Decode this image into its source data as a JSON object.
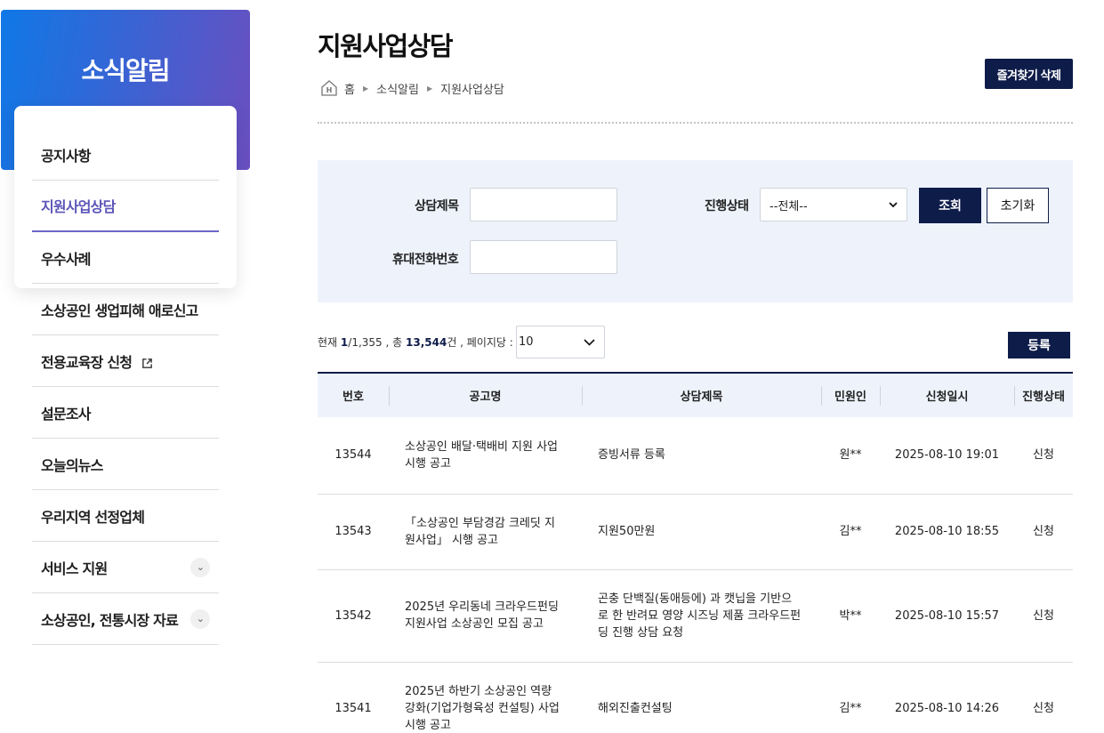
{
  "sidebar": {
    "title": "소식알림",
    "items": [
      {
        "label": "공지사항"
      },
      {
        "label": "지원사업상담"
      },
      {
        "label": "우수사례"
      },
      {
        "label": "소상공인 생업피해 애로신고"
      },
      {
        "label": "전용교육장 신청"
      },
      {
        "label": "설문조사"
      },
      {
        "label": "오늘의뉴스"
      },
      {
        "label": "우리지역 선정업체"
      },
      {
        "label": "서비스 지원"
      },
      {
        "label": "소상공인, 전통시장 자료"
      }
    ]
  },
  "header": {
    "title": "지원사업상담",
    "breadcrumb": [
      "홈",
      "소식알림",
      "지원사업상담"
    ],
    "fav_delete_label": "즐겨찾기 삭제"
  },
  "search": {
    "title_label": "상담제목",
    "title_value": "",
    "status_label": "진행상태",
    "status_value": "--전체--",
    "phone_label": "휴대전화번호",
    "phone_value": "",
    "search_button": "조회",
    "reset_button": "초기화"
  },
  "results": {
    "prefix_current": "현재 ",
    "current_page": "1",
    "total_pages": "/1,355 , 총 ",
    "total_count": "13,544",
    "suffix": "건 , 페이지당 :",
    "per_page": "10",
    "register_button": "등록"
  },
  "table": {
    "headers": [
      "번호",
      "공고명",
      "상담제목",
      "민원인",
      "신청일시",
      "진행상태"
    ],
    "rows": [
      [
        "13544",
        "소상공인 배달·택배비 지원 사업 시행 공고",
        "증빙서류 등록",
        "원**",
        "2025-08-10 19:01",
        "신청"
      ],
      [
        "13543",
        "「소상공인 부담경감 크레딧 지원사업」 시행 공고",
        "지원50만원",
        "김**",
        "2025-08-10 18:55",
        "신청"
      ],
      [
        "13542",
        "2025년 우리동네 크라우드펀딩 지원사업 소상공인 모집 공고",
        "곤충 단백질(동애등에) 과 캣닙을 기반으로 한 반려묘 영양 시즈닝 제품 크라우드펀딩 진행 상담 요청",
        "박**",
        "2025-08-10 15:57",
        "신청"
      ],
      [
        "13541",
        "2025년 하반기 소상공인 역량강화(기업가형육성 컨설팅) 사업 시행 공고",
        "해외진출컨설팅",
        "김**",
        "2025-08-10 14:26",
        "신청"
      ]
    ]
  }
}
